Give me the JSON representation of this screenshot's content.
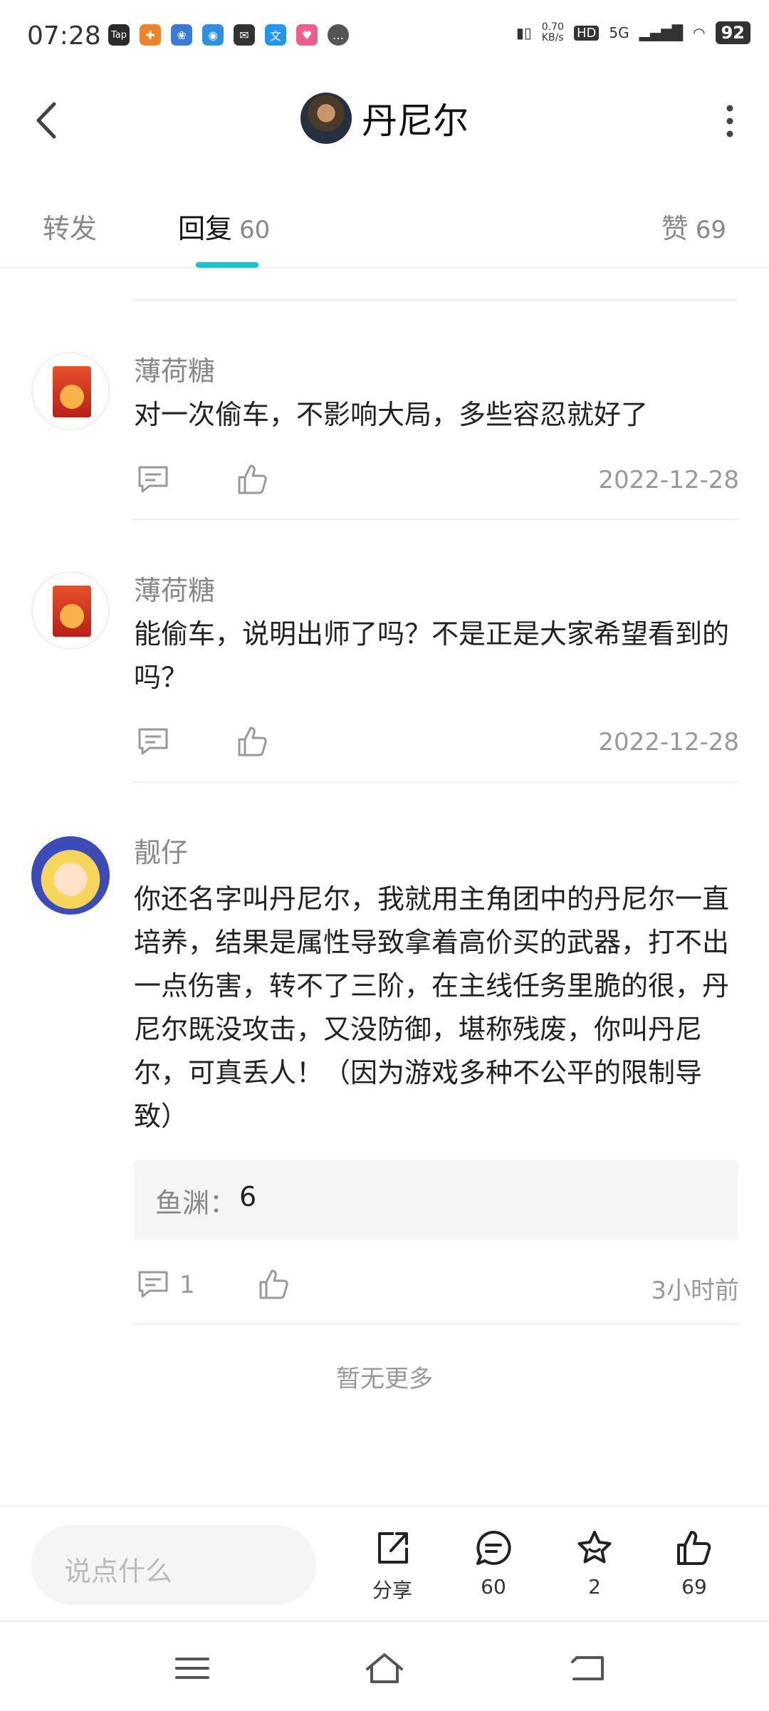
{
  "status_bar": {
    "time": "07:28",
    "network_speed": "0.70\nKB/s",
    "network_type": "5G",
    "battery": "92",
    "app_icons": [
      "tap-app-icon",
      "taobao-icon",
      "baidu-icon",
      "browser-icon",
      "mail-icon",
      "translate-icon",
      "lala-icon",
      "chat-icon"
    ]
  },
  "header": {
    "title": "丹尼尔"
  },
  "tabs": [
    {
      "label": "转发",
      "count": ""
    },
    {
      "label": "回复",
      "count": "60"
    },
    {
      "label": "赞",
      "count": "69"
    }
  ],
  "comments": [
    {
      "author": "薄荷糖",
      "text": "对一次偷车，不影响大局，多些容忍就好了",
      "date": "2022-12-28",
      "reply_count": ""
    },
    {
      "author": "薄荷糖",
      "text": "能偷车，说明出师了吗？不是正是大家希望看到的吗？",
      "date": "2022-12-28",
      "reply_count": ""
    },
    {
      "author": "靓仔",
      "text": "你还名字叫丹尼尔，我就用主角团中的丹尼尔一直培养，结果是属性导致拿着高价买的武器，打不出一点伤害，转不了三阶，在主线任务里脆的很，丹尼尔既没攻击，又没防御，堪称残废，你叫丹尼尔，可真丢人！（因为游戏多种不公平的限制导致）",
      "date": "3小时前",
      "reply_count": "1",
      "sub_reply": {
        "author": "鱼渊",
        "separator": "：",
        "text": "6"
      }
    }
  ],
  "no_more": "暂无更多",
  "bottom_bar": {
    "input_placeholder": "说点什么",
    "share_label": "分享",
    "comment_count": "60",
    "favorite_count": "2",
    "like_count": "69"
  },
  "colors": {
    "accent": "#1cc2cf",
    "text_primary": "#222222",
    "text_secondary": "#888888",
    "divider": "#eeeeee"
  }
}
